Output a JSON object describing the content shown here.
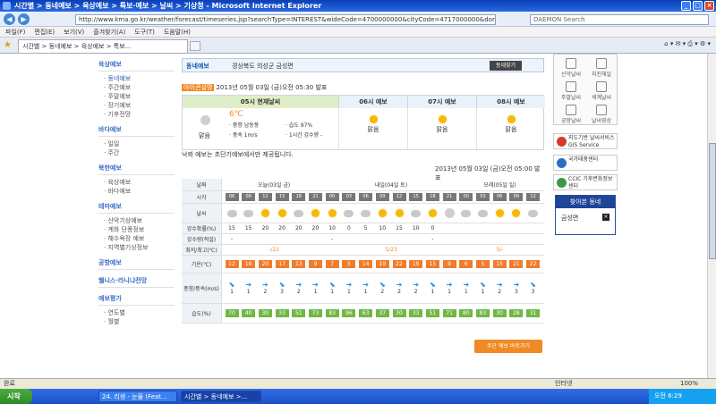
{
  "window": {
    "title": "시간별 > 동네예보 > 육상예보 > 특보·예보 > 날씨 > 기상청 - Microsoft Internet Explorer"
  },
  "address": {
    "url": "http://www.kma.go.kr/weather/forecast/timeseries.jsp?searchType=INTEREST&wideCode=4700000000&cityCode=4717000000&dongCode",
    "search_placeholder": "DAEMON Search"
  },
  "menu": [
    "파일(F)",
    "편집(E)",
    "보기(V)",
    "즐겨찾기(A)",
    "도구(T)",
    "도움말(H)"
  ],
  "tab": {
    "label": "시간별 > 동네예보 > 육상예보 > 특보..."
  },
  "leftnav": [
    {
      "title": "육상예보",
      "items": [
        "동네예보",
        "주간예보",
        "주말예보",
        "장기예보",
        "기후전망"
      ]
    },
    {
      "title": "바다예보",
      "items": [
        "일일",
        "주간"
      ]
    },
    {
      "title": "북한예보",
      "items": [
        "육상예보",
        "바다예보"
      ]
    },
    {
      "title": "테마예보",
      "items": [
        "산악기상예보",
        "계화 단풍정보",
        "해수욕장 예보",
        "지역별기상정보"
      ]
    },
    {
      "title": "공항예보",
      "items": []
    },
    {
      "title": "웰니스·라니냐전망",
      "items": []
    },
    {
      "title": "예보평가",
      "items": [
        "연도별",
        "월별"
      ]
    }
  ],
  "search": {
    "label": "동네예보",
    "location": "경상북도 의성군 금성면",
    "button": "동네찾기"
  },
  "announce": {
    "tag": "아이콘설명",
    "text": "2013년 05월 03일 (금)오전 05:30 발표"
  },
  "now": {
    "headers": [
      "05시 현재날씨",
      "06시 예보",
      "07시 예보",
      "08시 예보"
    ],
    "current": {
      "cond": "맑음",
      "temp": "6℃",
      "wind_dir": "· 풍향 남동풍",
      "wind_speed": "· 풍속 1m/s",
      "humidity": "· 습도 97%",
      "rain": "· 1시간 강수량 -"
    },
    "forecasts": [
      "맑음",
      "맑음",
      "맑음"
    ]
  },
  "note": "낙뢰 예보는 초단기예보에서만 제공됩니다.",
  "issued": "2013년 05월 03일 (금)오전 05:00 발표",
  "fc": {
    "row_labels": [
      "날짜",
      "시각",
      "날씨",
      "강수확률(%)",
      "강수량(적설)",
      "최저/최고(℃)",
      "기온(℃)",
      "풍향/풍속(m/s)",
      "습도(%)"
    ],
    "days": [
      "오늘(03일 금)",
      "내일(04일 토)",
      "모레(05일 일)"
    ],
    "hours": [
      "06",
      "09",
      "12",
      "15",
      "18",
      "21",
      "00",
      "03",
      "06",
      "09",
      "12",
      "15",
      "18",
      "21",
      "00",
      "03",
      "06",
      "09",
      "12"
    ],
    "rain_prob": [
      "15",
      "15",
      "20",
      "20",
      "20",
      "20",
      "10",
      "0",
      "5",
      "10",
      "15",
      "10",
      "0",
      "",
      "",
      "",
      "",
      "",
      ""
    ],
    "rain_amt": [
      "-",
      "",
      "",
      "",
      "",
      "",
      "-",
      "",
      "",
      "",
      "",
      "",
      "-",
      "",
      "",
      "",
      "",
      "",
      ""
    ],
    "minmax": [
      "-/22",
      "5/23",
      "5/-"
    ],
    "temps": [
      "12",
      "18",
      "20",
      "17",
      "13",
      "9",
      "7",
      "5",
      "14",
      "19",
      "22",
      "19",
      "15",
      "9",
      "6",
      "5",
      "15",
      "21",
      "22"
    ],
    "wind": [
      "1",
      "1",
      "2",
      "3",
      "2",
      "1",
      "1",
      "1",
      "1",
      "2",
      "2",
      "2",
      "1",
      "1",
      "1",
      "1",
      "2",
      "3",
      "3"
    ],
    "humidity": [
      "70",
      "40",
      "30",
      "33",
      "51",
      "73",
      "83",
      "96",
      "63",
      "37",
      "30",
      "33",
      "51",
      "71",
      "80",
      "83",
      "30",
      "28",
      "31"
    ],
    "weekly_button": "주간 예보 바로가기"
  },
  "right": {
    "icons": [
      "산악날씨",
      "지진해일",
      "주말날씨",
      "세계날씨",
      "공항날씨",
      "날씨영상"
    ],
    "banners": [
      "지도기반 날씨서비스 GIS Service",
      "국가태풍센터",
      "CCIC 기후변화정보센터"
    ],
    "fav_title": "찾아본 동네",
    "fav_item": "금성면"
  },
  "status": {
    "left": "완료",
    "zone": "인터넷",
    "zoom": "100%"
  },
  "taskbar": {
    "start": "시작",
    "tasks": [
      "24. 리생 - 눈물 (Feat...",
      "시간별 > 동네예보 >..."
    ],
    "clock": "오전 6:29"
  }
}
